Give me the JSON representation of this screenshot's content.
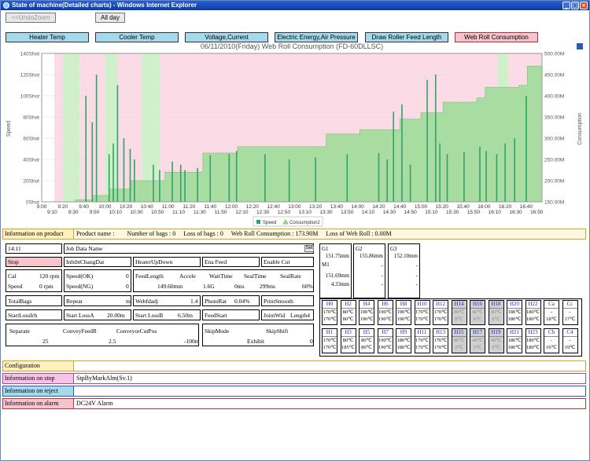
{
  "window": {
    "title": "State of machine(Detailed charts) - Windows Internet Explorer"
  },
  "toolbar": {
    "undo_zoom": "<<UndoZoom",
    "all_day": "All day"
  },
  "tabs": [
    "Heater Temp",
    "Cooler Temp",
    "Voltage,Current",
    "Electric Energy,Air Pressure",
    "Draw Roller Feed Length",
    "Web Roll Consumption"
  ],
  "colors": {
    "tab": "#a6d9ec",
    "tab_selected": "#f7c3cd",
    "speed": "#2fa36b",
    "consumption": "#a8dca0",
    "stop_band": "#fbdce6",
    "run_band": "#cff0c9"
  },
  "chart_data": {
    "type": "area",
    "title": "06/11/2010(Friday) Web Roll Consumption  (FD-60DLLSC)",
    "ylabel": "Speed",
    "ylabel2": "Consumption",
    "yticks_left": [
      "0Shot",
      "20Shot",
      "40Shot",
      "60Shot",
      "80Shot",
      "100Shot",
      "120Shot",
      "140Shot"
    ],
    "yticks_right": [
      "150.00M",
      "200.00M",
      "250.00M",
      "300.00M",
      "350.00M",
      "400.00M",
      "450.00M",
      "500.00M"
    ],
    "xticks_top": [
      "9:00",
      "9:20",
      "9:40",
      "10:00",
      "10:20",
      "10:40",
      "11:00",
      "11:20",
      "11:40",
      "12:00",
      "12:20",
      "12:40",
      "13:00",
      "13:20",
      "13:40",
      "14:00",
      "14:20",
      "14:40",
      "15:00",
      "15:20",
      "15:40",
      "16:00",
      "16:20",
      "16:40"
    ],
    "xticks_bottom": [
      "9:10",
      "9:30",
      "9:50",
      "10:10",
      "10:30",
      "10:50",
      "11:10",
      "11:30",
      "11:50",
      "12:10",
      "12:30",
      "12:50",
      "13:10",
      "13:30",
      "13:50",
      "14:10",
      "14:30",
      "14:50",
      "15:10",
      "15:30",
      "15:50",
      "16:10",
      "16:30",
      "16:50"
    ],
    "legend": [
      "Speed",
      "Consumption2"
    ],
    "xlim_min": [
      540,
      1015
    ],
    "ylim_left": [
      0,
      140
    ],
    "ylim_right": [
      150,
      500
    ],
    "consumption_steps": [
      [
        572,
        155
      ],
      [
        588,
        165
      ],
      [
        604,
        180
      ],
      [
        625,
        200
      ],
      [
        657,
        220
      ],
      [
        693,
        265
      ],
      [
        726,
        280
      ],
      [
        810,
        310
      ],
      [
        842,
        320
      ],
      [
        880,
        345
      ],
      [
        900,
        360
      ],
      [
        921,
        385
      ],
      [
        953,
        395
      ],
      [
        961,
        420
      ],
      [
        993,
        425
      ],
      [
        1001,
        470
      ],
      [
        1015,
        470
      ]
    ],
    "stop_bands": [
      [
        552,
        560
      ],
      [
        576,
        600
      ],
      [
        612,
        635
      ],
      [
        652,
        1015
      ]
    ],
    "run_bands": [
      [
        560,
        576
      ],
      [
        600,
        612
      ],
      [
        635,
        652
      ],
      [
        973,
        983
      ]
    ],
    "speed_spikes": [
      [
        582,
        100
      ],
      [
        588,
        75
      ],
      [
        592,
        120
      ],
      [
        604,
        45
      ],
      [
        608,
        55
      ],
      [
        612,
        110
      ],
      [
        618,
        60
      ],
      [
        624,
        50
      ],
      [
        628,
        40
      ],
      [
        646,
        35
      ],
      [
        652,
        30
      ],
      [
        664,
        38
      ],
      [
        672,
        35
      ],
      [
        676,
        30
      ],
      [
        688,
        32
      ],
      [
        700,
        44
      ],
      [
        718,
        45
      ],
      [
        725,
        48
      ],
      [
        752,
        45
      ],
      [
        775,
        40
      ],
      [
        800,
        42
      ],
      [
        830,
        45
      ],
      [
        860,
        46
      ],
      [
        868,
        40
      ],
      [
        874,
        85
      ],
      [
        882,
        92
      ],
      [
        890,
        35
      ],
      [
        906,
        115
      ],
      [
        914,
        120
      ],
      [
        918,
        55
      ],
      [
        925,
        45
      ],
      [
        941,
        47
      ],
      [
        956,
        52
      ],
      [
        962,
        48
      ],
      [
        972,
        45
      ],
      [
        980,
        55
      ],
      [
        989,
        60
      ],
      [
        1000,
        100
      ]
    ]
  },
  "product": {
    "label": "Information on product",
    "text": "Product name :        Number of bags : 0     Loss of bags : 0     Web Roll Consumption : 173.90M     Loss of Web Roll : 0.00M"
  },
  "machine": {
    "time": "14:11",
    "job_label": "Job Data Name",
    "set": "Set",
    "stop": "Stop",
    "inhibit": "InhibtChangDat",
    "heater": "HeaterUpDown",
    "ena_feed": "Ena Feed",
    "enable_cut": "Enable Cut",
    "cal": "Cal",
    "cal_v": "120 rpm",
    "speed": "Speed",
    "speed_v": "0 rpm",
    "speed_ok": "Speed(OK)",
    "speed_ok_v": "0",
    "speed_ng": "Speed(NG)",
    "speed_ng_v": "0",
    "feedlength": "FeedLength",
    "feedlength_v": "149.60mm",
    "accele": "Accele",
    "accele_v": "1.6G",
    "waittime": "WaitTime",
    "waittime_v": "0ms",
    "sealtime": "SealTime",
    "sealtime_v": "299ms",
    "sealrate": "SealRate",
    "sealrate_v": "60%",
    "total": "TotalBags",
    "repeat": "Repeat",
    "repeat_v": "m",
    "webadj": "Webfdadj",
    "webadj_v": "1.4",
    "photo": "PhotoRat",
    "photo_v": "0.04%",
    "print": "PrintSmooth",
    "startloss": "StartLossIrh",
    "startlossA": "Start LossA",
    "startlossA_v": "20.00m",
    "startlossB": "Start LossB",
    "startlossB_v": "6.50m",
    "feedstart": "FeedStart",
    "jointwid": "JointWid",
    "length4": "Length4",
    "separate": "Separate",
    "separate_v": "25",
    "conveyfr": "ConveyFeedR",
    "conveyfr_v": "2.5",
    "conveyp": "ConveyorCutPos",
    "conveyp_v": "-100ms",
    "skipmode": "SkipMode",
    "skipmode_v": "Exhibit",
    "skipshift": "SkipShift",
    "skipshift_v": "0"
  },
  "gauges": [
    {
      "name": "G1",
      "lines": [
        "151.75mm"
      ],
      "m_label": "M1",
      "m_lines": [
        "151.69mm",
        "4.33mm"
      ]
    },
    {
      "name": "G2",
      "lines": [
        "155.86mm",
        "-"
      ],
      "m_lines": [
        "-",
        "-"
      ]
    },
    {
      "name": "G3",
      "lines": [
        "152.10mm",
        "-"
      ],
      "m_lines": [
        "-",
        "-"
      ]
    }
  ],
  "heaters_top": [
    {
      "n": "H0",
      "a": "170℃",
      "b": "170℃"
    },
    {
      "n": "H2",
      "a": "80℃",
      "b": "80℃"
    },
    {
      "n": "H4",
      "a": "190℃",
      "b": "190℃"
    },
    {
      "n": "H6",
      "a": "190℃",
      "b": "190℃"
    },
    {
      "n": "H8",
      "a": "190℃",
      "b": "190℃"
    },
    {
      "n": "H10",
      "a": "170℃",
      "b": "170℃"
    },
    {
      "n": "H12",
      "a": "170℃",
      "b": "170℃"
    },
    {
      "n": "H14",
      "a": "40℃",
      "b": "0℃",
      "dim": true
    },
    {
      "n": "H16",
      "a": "40℃",
      "b": "0℃",
      "dim": true
    },
    {
      "n": "H18",
      "a": "40℃",
      "b": "0℃",
      "dim": true
    },
    {
      "n": "H20",
      "a": "180℃",
      "b": "180℃"
    },
    {
      "n": "H22",
      "a": "180℃",
      "b": "180℃"
    },
    {
      "n": "Ca",
      "a": "-",
      "b": "18℃"
    },
    {
      "n": "Cc",
      "a": "-",
      "b": "17℃"
    }
  ],
  "heaters_bottom": [
    {
      "n": "H1",
      "a": "170℃",
      "b": "170℃"
    },
    {
      "n": "H3",
      "a": "80℃",
      "b": "185℃"
    },
    {
      "n": "H5",
      "a": "80℃",
      "b": "80℃"
    },
    {
      "n": "H7",
      "a": "190℃",
      "b": "190℃"
    },
    {
      "n": "H9",
      "a": "180℃",
      "b": "180℃"
    },
    {
      "n": "H11",
      "a": "170℃",
      "b": "170℃"
    },
    {
      "n": "H13",
      "a": "170℃",
      "b": "170℃"
    },
    {
      "n": "H15",
      "a": "40℃",
      "b": "0℃",
      "dim": true
    },
    {
      "n": "H17",
      "a": "40℃",
      "b": "0℃",
      "dim": true
    },
    {
      "n": "H19",
      "a": "40℃",
      "b": "0℃",
      "dim": true
    },
    {
      "n": "H21",
      "a": "180℃",
      "b": "180℃"
    },
    {
      "n": "H23",
      "a": "180℃",
      "b": "180℃"
    },
    {
      "n": "Cb",
      "a": "-",
      "b": "16℃"
    },
    {
      "n": "C4",
      "a": "-",
      "b": "19℃"
    }
  ],
  "info": [
    {
      "label": "Configuration",
      "value": "",
      "color": "#fff0c0",
      "border": "#e0a020"
    },
    {
      "label": "Information on stop",
      "value": "StpByMarkAlm(Sv.1)",
      "color": "#f7c3e8",
      "border": "#c040a0"
    },
    {
      "label": "Information on reject",
      "value": "",
      "color": "#a6d9ec",
      "border": "#2060c0"
    },
    {
      "label": "Information on alarm",
      "value": "DC24V Alarm",
      "color": "#f7c3cd",
      "border": "#c03040"
    }
  ]
}
